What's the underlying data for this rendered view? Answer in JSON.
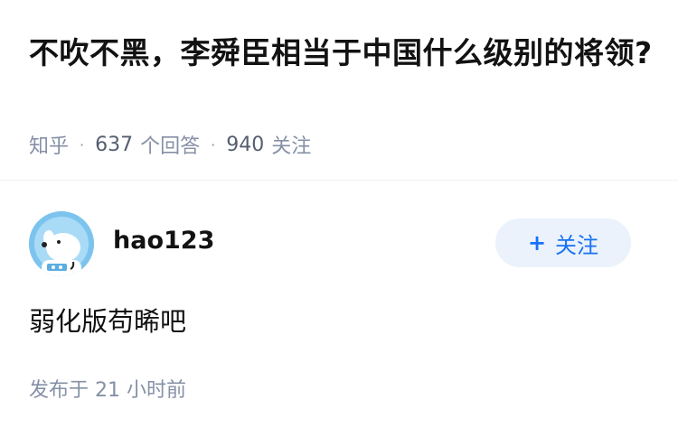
{
  "question": {
    "title": "不吹不黑，李舜臣相当于中国什么级别的将领?",
    "source": "知乎",
    "answers_count": "637",
    "answers_label": "个回答",
    "followers_count": "940",
    "followers_label": "关注"
  },
  "answer": {
    "author_name": "hao123",
    "follow_plus": "+",
    "follow_label": "关注",
    "content": "弱化版苟晞吧",
    "time_prefix": "发布于",
    "time_value": "21 小时前"
  },
  "colors": {
    "accent": "#1772f6",
    "follow_bg": "#ebf2fb",
    "meta": "#8590a6",
    "avatar_bg": "#7cc4ee"
  },
  "icons": {
    "avatar": "astronaut-dog-avatar"
  }
}
